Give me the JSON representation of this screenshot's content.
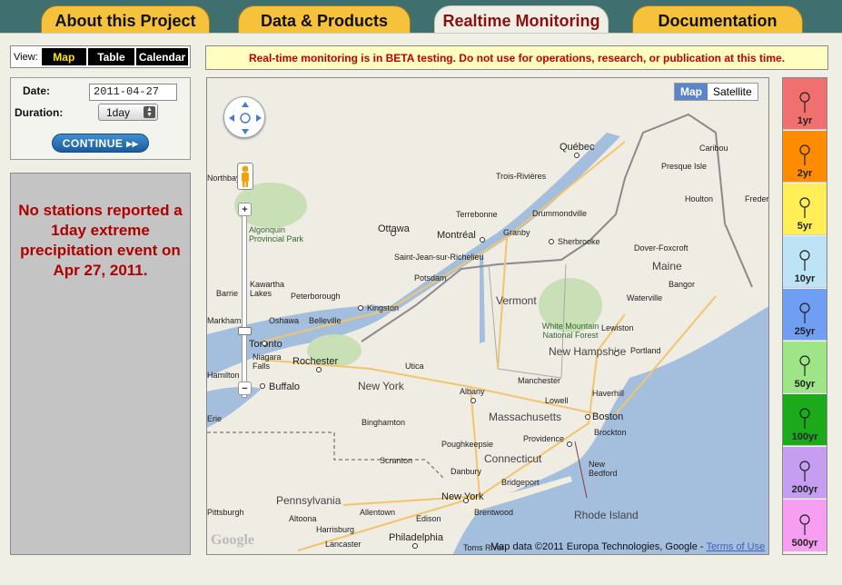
{
  "tabs": [
    {
      "label": "About this Project"
    },
    {
      "label": "Data & Products"
    },
    {
      "label": "Realtime Monitoring"
    },
    {
      "label": "Documentation"
    }
  ],
  "view": {
    "label": "View:",
    "buttons": [
      "Map",
      "Table",
      "Calendar"
    ],
    "selected": "Map"
  },
  "form": {
    "date_label": "Date:",
    "date_value": "2011-04-27",
    "duration_label": "Duration:",
    "duration_value": "1day",
    "continue_label": "CONTINUE ▸▸"
  },
  "message": "No stations reported a 1day extreme precipitation event on Apr 27, 2011.",
  "beta_notice": "Real-time monitoring is in BETA testing. Do not use for operations, research, or publication at this time.",
  "map": {
    "type_buttons": [
      "Map",
      "Satellite"
    ],
    "copyright": "Map data ©2011 Europa Technologies, Google - ",
    "terms": "Terms of Use",
    "logo": "Google",
    "states": [
      "Vermont",
      "New Hampshire",
      "Maine",
      "New York",
      "Massachusetts",
      "Connecticut",
      "Pennsylvania",
      "Rhode Island"
    ],
    "cities": [
      "Québec",
      "Trois-Rivières",
      "Terrebonne",
      "Drummondville",
      "Montréal",
      "Granby",
      "Sherbrooke",
      "Ottawa",
      "Saint-Jean-sur-Richelieu",
      "Potsdam",
      "Kingston",
      "Kawartha Lakes",
      "Peterborough",
      "Barrie",
      "Oshawa",
      "Belleville",
      "Markham",
      "Toronto",
      "Niagara Falls",
      "Hamilton",
      "Buffalo",
      "Rochester",
      "Utica",
      "Albany",
      "Binghamton",
      "Scranton",
      "Poughkeepsie",
      "Danbury",
      "Bridgeport",
      "New York",
      "Allentown",
      "Edison",
      "Brentwood",
      "Philadelphia",
      "Harrisburg",
      "Lancaster",
      "Altoona",
      "Pittsburgh",
      "Erie",
      "Toms River",
      "Portland",
      "Bangor",
      "Waterville",
      "Lewiston",
      "Dover-Foxcroft",
      "Houlton",
      "Presque Isle",
      "Caribou",
      "Manchester",
      "Lowell",
      "Haverhill",
      "Boston",
      "Brockton",
      "Providence",
      "New Bedford",
      "Northbay",
      "Algonquin Provincial Park",
      "White Mountain National Forest",
      "Fredericton"
    ]
  },
  "legend": [
    {
      "label": "1yr",
      "color": "#f07070"
    },
    {
      "label": "2yr",
      "color": "#ff8c00"
    },
    {
      "label": "5yr",
      "color": "#ffee55"
    },
    {
      "label": "10yr",
      "color": "#bde3f6"
    },
    {
      "label": "25yr",
      "color": "#6f9ef2"
    },
    {
      "label": "50yr",
      "color": "#9ee587"
    },
    {
      "label": "100yr",
      "color": "#1aaa1a"
    },
    {
      "label": "200yr",
      "color": "#c59ef2"
    },
    {
      "label": "500yr",
      "color": "#f59ef2"
    }
  ]
}
